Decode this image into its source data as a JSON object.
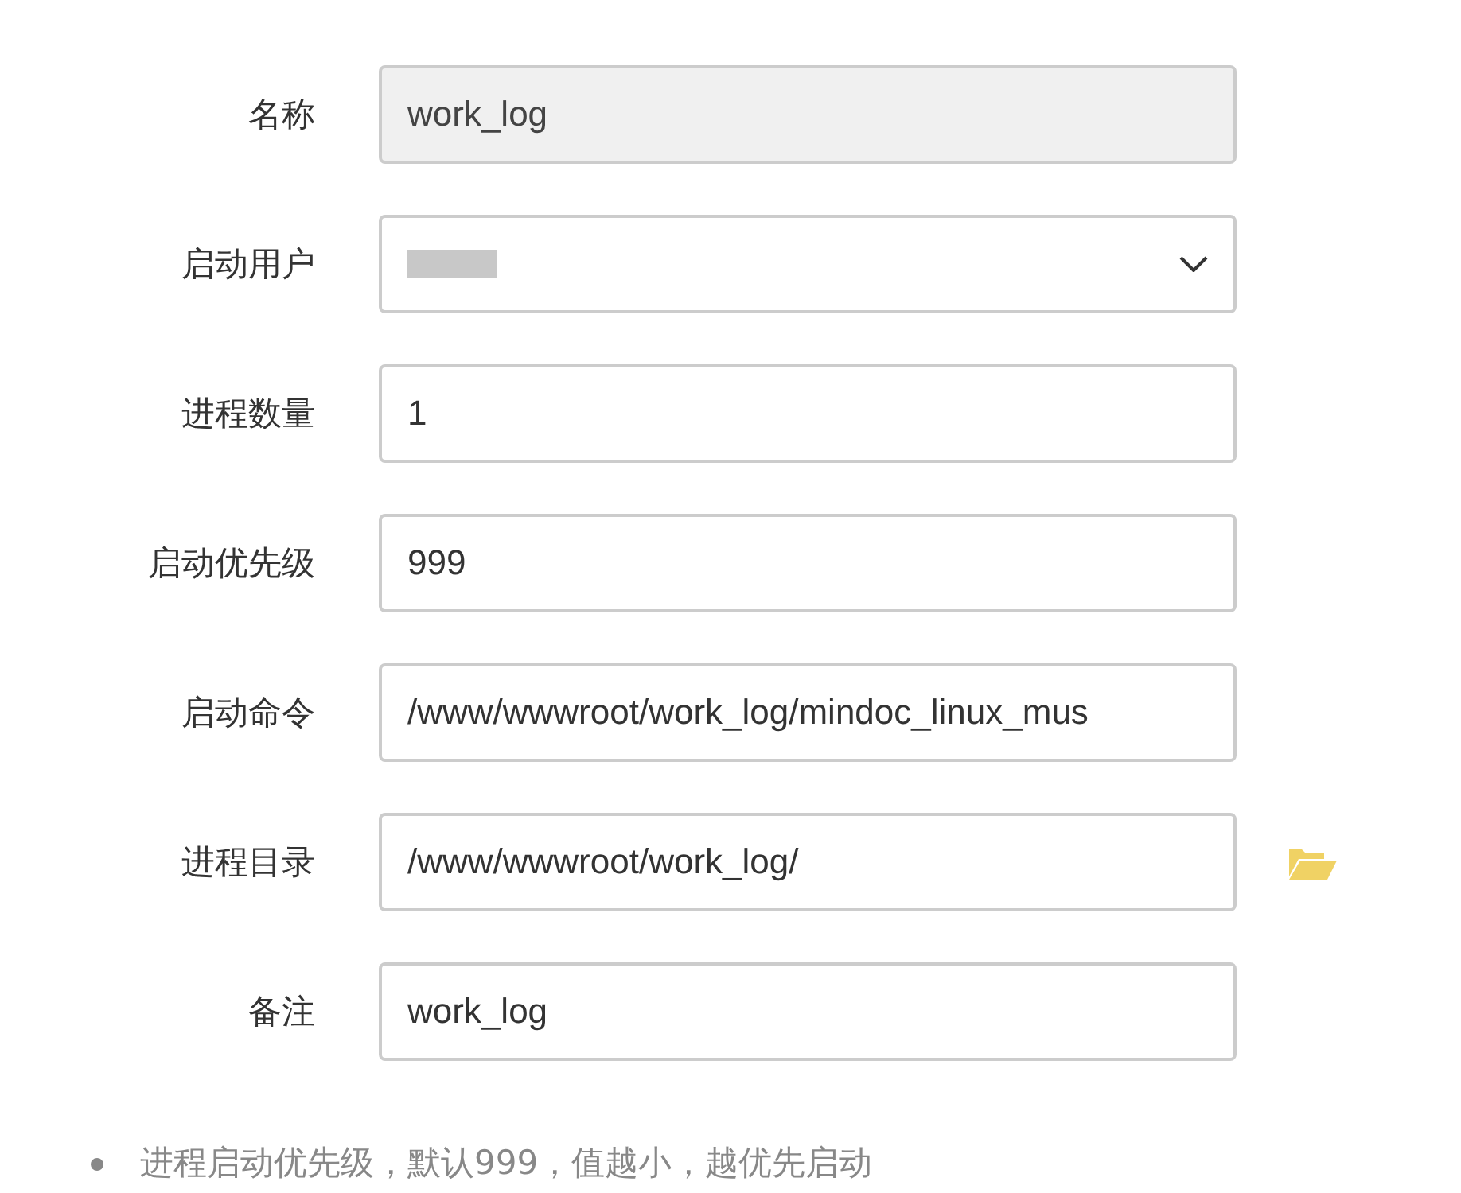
{
  "fields": [
    {
      "label": "名称",
      "kind": "text",
      "value": "work_log",
      "disabled": true
    },
    {
      "label": "启动用户",
      "kind": "select",
      "disabled": false
    },
    {
      "label": "进程数量",
      "kind": "text",
      "value": "1",
      "disabled": false
    },
    {
      "label": "启动优先级",
      "kind": "text",
      "value": "999",
      "disabled": false
    },
    {
      "label": "启动命令",
      "kind": "text",
      "value": "/www/wwwroot/work_log/mindoc_linux_mus",
      "disabled": false
    },
    {
      "label": "进程目录",
      "kind": "folder",
      "value": "/www/wwwroot/work_log/",
      "disabled": false
    },
    {
      "label": "备注",
      "kind": "text",
      "value": "work_log",
      "disabled": false
    }
  ],
  "notes": [
    "进程启动优先级，默认999，值越小，越优先启动"
  ]
}
